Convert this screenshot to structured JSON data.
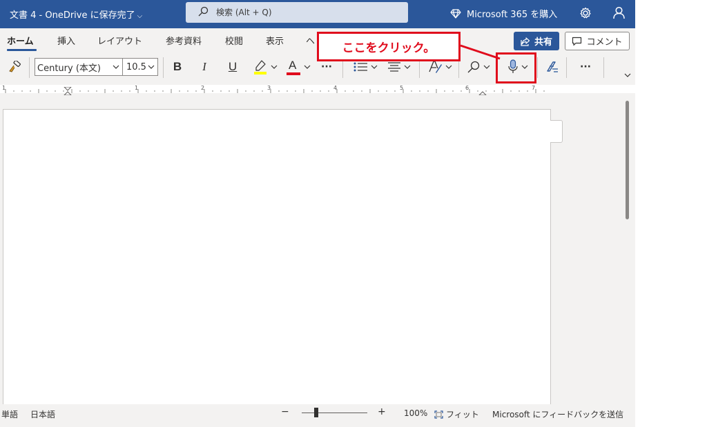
{
  "titlebar": {
    "doc_title": "文書 4 - OneDrive に保存完了",
    "search_placeholder": "検索 (Alt + Q)",
    "buy_label": "Microsoft 365 を購入"
  },
  "tabs": [
    {
      "label": "ホーム",
      "active": true
    },
    {
      "label": "挿入"
    },
    {
      "label": "レイアウト"
    },
    {
      "label": "参考資料"
    },
    {
      "label": "校閲"
    },
    {
      "label": "表示"
    },
    {
      "label": "ヘ"
    }
  ],
  "actions": {
    "share_label": "共有",
    "comment_label": "コメント"
  },
  "toolbar": {
    "font_name": "Century (本文)",
    "font_size": "10.5",
    "bold": "B",
    "italic": "I",
    "underline": "U",
    "font_color": "A",
    "more": "···"
  },
  "ruler": {
    "numbers": [
      "1",
      "1",
      "2",
      "3",
      "4",
      "5",
      "6",
      "7"
    ]
  },
  "statusbar": {
    "words": "単語",
    "language": "日本語",
    "zoom_out": "−",
    "zoom_in": "+",
    "zoom_level": "100%",
    "fit": "フィット",
    "feedback": "Microsoft にフィードバックを送信"
  },
  "annotation": {
    "text": "ここをクリック。",
    "color": "#e00b1c"
  },
  "colors": {
    "brand": "#2b579a",
    "highlight": "#ffff00",
    "font_color_bar": "#e00b1c"
  }
}
